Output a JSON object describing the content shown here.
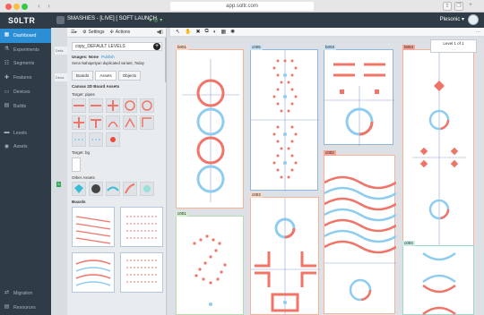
{
  "browser": {
    "url": "app.soltr.com"
  },
  "app": {
    "logo": "S0LTR",
    "project_title": "SMASHIES - [LIVE] [ SOFT LAUNCH",
    "user_name": "Plesonic ▾",
    "status_dots": "● ◎ ▾"
  },
  "nav": {
    "items": [
      {
        "label": "Dashboard",
        "icon": "dashboard-icon",
        "glyph": "▦"
      },
      {
        "label": "Experiments",
        "icon": "flask-icon",
        "glyph": "⚗"
      },
      {
        "label": "Segments",
        "icon": "people-icon",
        "glyph": "☷"
      },
      {
        "label": "Features",
        "icon": "puzzle-icon",
        "glyph": "✚"
      },
      {
        "label": "Devices",
        "icon": "device-icon",
        "glyph": "▭"
      },
      {
        "label": "Builds",
        "icon": "build-icon",
        "glyph": "▤"
      },
      {
        "label": "Levels",
        "icon": "levels-icon",
        "glyph": "▬"
      },
      {
        "label": "Assets",
        "icon": "assets-icon",
        "glyph": "◉"
      }
    ],
    "bottom": [
      {
        "label": "Migration",
        "icon": "migration-icon",
        "glyph": "⇄"
      },
      {
        "label": "Resources",
        "icon": "resources-icon",
        "glyph": "▤"
      }
    ]
  },
  "strip": {
    "pill_a": "Defa",
    "pill_b": "Deca",
    "green": "5"
  },
  "panel": {
    "settings_label": "Settings",
    "actions_label": "Actions",
    "collapse_label": "◂◧",
    "level_name": "copy_DEFAULT LEVELS",
    "usage_label": "Usages: None",
    "publish_label": "Publish",
    "byline": "Sena Nahapetyan duplicated variant, Today",
    "tabs": [
      "Boards",
      "Assets",
      "Objects"
    ],
    "section_title": "Canvas 2D Board Assets",
    "target_pipes": "Target: pipes",
    "target_bg": "Target: bg",
    "other_assets": "Other Assets",
    "boards_label": "Boards"
  },
  "canvas": {
    "level_popup": "Level 1 of 1",
    "level_popup_sub": "...",
    "overflow": "⋯",
    "boards": [
      "b001",
      "c005",
      "b003",
      "b004",
      "c002",
      "c001",
      "c003",
      "c004"
    ]
  },
  "colors": {
    "accent": "#2c8fd6",
    "red": "#f07467",
    "blue": "#8fcdf0",
    "nav_bg": "#2f3b46"
  }
}
